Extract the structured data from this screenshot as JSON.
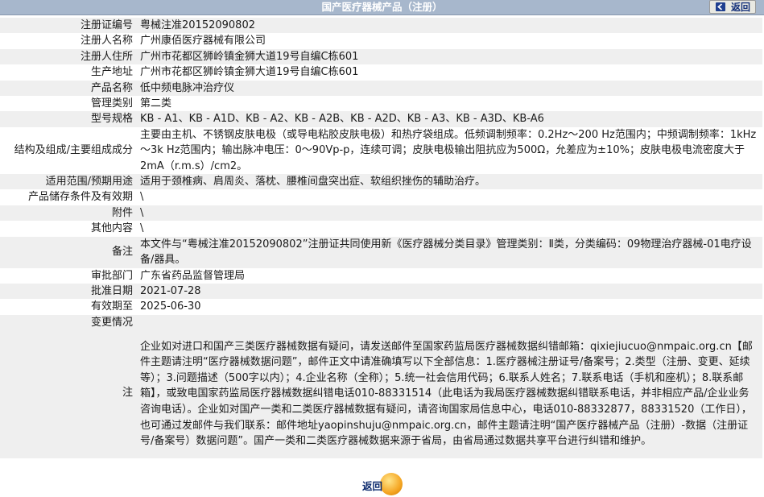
{
  "header": {
    "title": "国产医疗器械产品（注册）",
    "back_label": "返回"
  },
  "rows": [
    {
      "label": "注册证编号",
      "value": "粤械注准20152090802"
    },
    {
      "label": "注册人名称",
      "value": "广州康佰医疗器械有限公司"
    },
    {
      "label": "注册人住所",
      "value": "广州市花都区狮岭镇金狮大道19号自编C栋601"
    },
    {
      "label": "生产地址",
      "value": "广州市花都区狮岭镇金狮大道19号自编C栋601"
    },
    {
      "label": "产品名称",
      "value": "低中频电脉冲治疗仪"
    },
    {
      "label": "管理类别",
      "value": "第二类"
    },
    {
      "label": "型号规格",
      "value": "KB - A1、KB - A1D、KB - A2、KB - A2B、KB - A2D、KB - A3、KB - A3D、KB-A6"
    },
    {
      "label": "结构及组成/主要组成成分",
      "value": "主要由主机、不锈钢皮肤电极（或导电粘胶皮肤电极）和热疗袋组成。低频调制频率：0.2Hz～200 Hz范围内；中频调制频率：1kHz～3k Hz范围内；输出脉冲电压：0～90Vp-p，连续可调；皮肤电极输出阻抗应为500Ω，允差应为±10%；皮肤电极电流密度大于2mA（r.m.s）/cm2。"
    },
    {
      "label": "适用范围/预期用途",
      "value": "适用于颈椎病、肩周炎、落枕、腰椎间盘突出症、软组织挫伤的辅助治疗。"
    },
    {
      "label": "产品储存条件及有效期",
      "value": "\\"
    },
    {
      "label": "附件",
      "value": "\\"
    },
    {
      "label": "其他内容",
      "value": "\\"
    },
    {
      "label": "备注",
      "value": "本文件与“粤械注准20152090802”注册证共同使用新《医疗器械分类目录》管理类别：Ⅱ类，分类编码：09物理治疗器械-01电疗设备/器具。"
    },
    {
      "label": "审批部门",
      "value": "广东省药品监督管理局"
    },
    {
      "label": "批准日期",
      "value": "2021-07-28"
    },
    {
      "label": "有效期至",
      "value": "2025-06-30"
    }
  ],
  "changes": {
    "label": "变更情况",
    "value": ""
  },
  "note": {
    "label": "注",
    "value": "企业如对进口和国产三类医疗器械数据有疑问，请发送邮件至国家药监局医疗器械数据纠错邮箱：qixiejiucuo@nmpaic.org.cn【邮件主题请注明“医疗器械数据问题”，邮件正文中请准确填写以下全部信息：1.医疗器械注册证号/备案号；2.类型（注册、变更、延续等）；3.问题描述（500字以内）；4.企业名称（全称）；5.统一社会信用代码；6.联系人姓名；7.联系电话（手机和座机）；8.联系邮箱】，或致电国家药监局医疗器械数据纠错电话010-88331514（此电话为我局医疗器械数据纠错联系电话，并非相应产品/企业业务咨询电话）。企业如对国产一类和二类医疗器械数据有疑问，请咨询国家局信息中心，电话010-88332877，88331520（工作日），也可通过发邮件与我们联系：邮件地址yaopinshuju@nmpaic.org.cn，邮件主题请注明“国产医疗器械产品（注册）-数据（注册证号/备案号）数据问题”。国产一类和二类医疗器械数据来源于省局，由省局通过数据共享平台进行纠错和维护。"
  },
  "footer": {
    "back_label": "返回"
  },
  "colors": {
    "header_bg": "#a7b7cc",
    "row_alt_bg": "#efefef",
    "back_text": "#14307a"
  }
}
